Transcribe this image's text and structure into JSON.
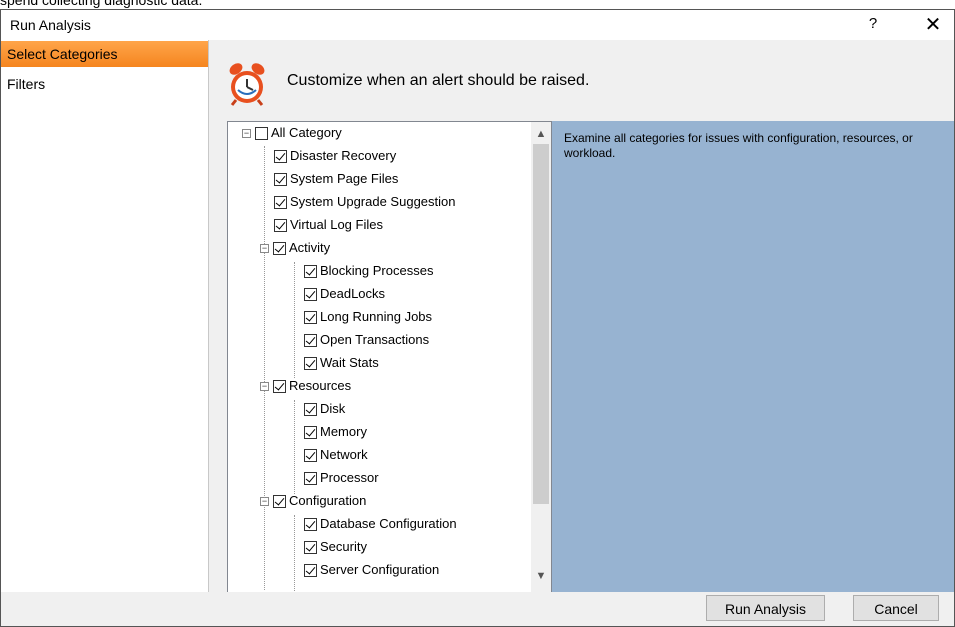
{
  "top_text": "spend collecting diagnostic data.",
  "window": {
    "title": "Run Analysis",
    "help_glyph": "?",
    "close_glyph": "✕"
  },
  "sidebar": {
    "items": [
      {
        "label": "Select Categories",
        "selected": true
      },
      {
        "label": "Filters",
        "selected": false
      }
    ]
  },
  "main": {
    "header": "Customize when an alert should be raised."
  },
  "tree": {
    "items": [
      {
        "label": "All Category",
        "checked": false,
        "level": 0,
        "expandable": true
      },
      {
        "label": "Disaster Recovery",
        "checked": true,
        "level": 1
      },
      {
        "label": "System Page Files",
        "checked": true,
        "level": 1
      },
      {
        "label": "System Upgrade Suggestion",
        "checked": true,
        "level": 1
      },
      {
        "label": "Virtual Log Files",
        "checked": true,
        "level": 1
      },
      {
        "label": "Activity",
        "checked": true,
        "level": 1,
        "expandable": true
      },
      {
        "label": "Blocking Processes",
        "checked": true,
        "level": 2
      },
      {
        "label": "DeadLocks",
        "checked": true,
        "level": 2
      },
      {
        "label": "Long Running Jobs",
        "checked": true,
        "level": 2
      },
      {
        "label": "Open Transactions",
        "checked": true,
        "level": 2
      },
      {
        "label": "Wait Stats",
        "checked": true,
        "level": 2
      },
      {
        "label": "Resources",
        "checked": true,
        "level": 1,
        "expandable": true
      },
      {
        "label": "Disk",
        "checked": true,
        "level": 2
      },
      {
        "label": "Memory",
        "checked": true,
        "level": 2
      },
      {
        "label": "Network",
        "checked": true,
        "level": 2
      },
      {
        "label": "Processor",
        "checked": true,
        "level": 2
      },
      {
        "label": "Configuration",
        "checked": true,
        "level": 1,
        "expandable": true
      },
      {
        "label": "Database Configuration",
        "checked": true,
        "level": 2
      },
      {
        "label": "Security",
        "checked": true,
        "level": 2
      },
      {
        "label": "Server Configuration",
        "checked": true,
        "level": 2
      }
    ]
  },
  "description": "Examine all categories for issues with configuration, resources, or workload.",
  "footer": {
    "run_label": "Run Analysis",
    "cancel_label": "Cancel"
  },
  "colors": {
    "selected_item": "#f5851f",
    "description_bg": "#97b3d1",
    "icon": "#e8501f"
  }
}
